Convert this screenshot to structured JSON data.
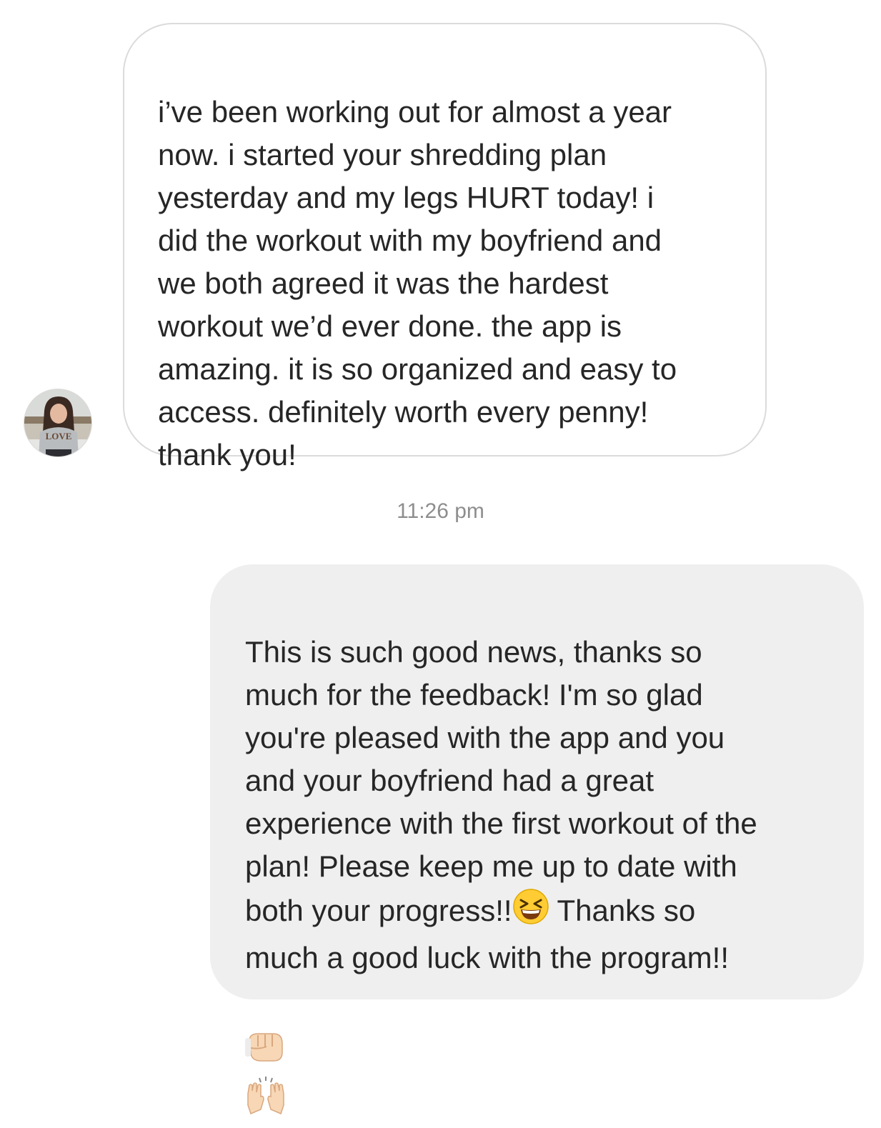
{
  "thread": {
    "incoming": {
      "text": "i’ve been working out for almost a year\nnow. i started your shredding plan\nyesterday and my legs HURT today! i\ndid the workout with my boyfriend and\nwe both agreed it was the hardest\nworkout we’d ever done. the app is\namazing. it is so organized and easy to\naccess. definitely worth every penny!\nthank you!"
    },
    "timestamp": "11:26 pm",
    "outgoing": {
      "text_part1": "This is such good news, thanks so\nmuch for the feedback! I'm so glad\nyou're pleased with the app and you\nand your boyfriend had a great\nexperience with the first workout of the\nplan! Please keep me up to date with\nboth your progress!!",
      "text_part2": " Thanks so\nmuch a good luck with the program!!",
      "emojis": [
        "grinning-squinting-face-emoji",
        "fist-bump-emoji",
        "raising-hands-emoji"
      ]
    }
  },
  "colors": {
    "incoming_bubble_border": "#dbdbdb",
    "outgoing_bubble_bg": "#efefef",
    "text": "#262626",
    "timestamp": "#8e8e8e"
  }
}
